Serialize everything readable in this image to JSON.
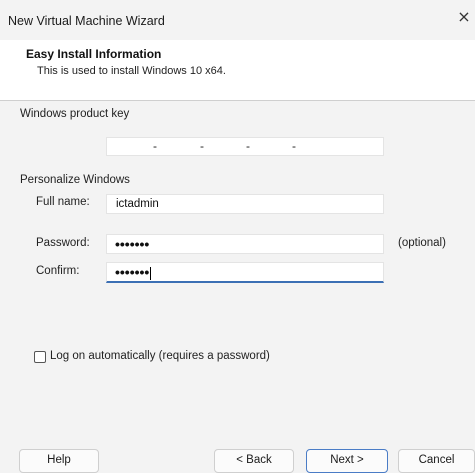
{
  "window": {
    "title": "New Virtual Machine Wizard",
    "close_glyph": "×"
  },
  "header": {
    "title": "Easy Install Information",
    "subtitle": "This is used to install Windows 10 x64."
  },
  "product_key": {
    "label": "Windows product key",
    "value": "",
    "separator": "-"
  },
  "personalize": {
    "label": "Personalize Windows",
    "full_name_label": "Full name:",
    "full_name_value": "ictadmin",
    "password_label": "Password:",
    "password_mask": "•••••••",
    "password_note": "(optional)",
    "confirm_label": "Confirm:",
    "confirm_mask": "•••••••"
  },
  "autologon": {
    "label": "Log on automatically (requires a password)",
    "checked": false
  },
  "buttons": {
    "help": "Help",
    "back": "< Back",
    "next": "Next >",
    "cancel": "Cancel"
  },
  "colors": {
    "accent": "#3b6fb4",
    "background": "#f3f3f3"
  },
  "icons": {
    "close": "close-icon"
  }
}
